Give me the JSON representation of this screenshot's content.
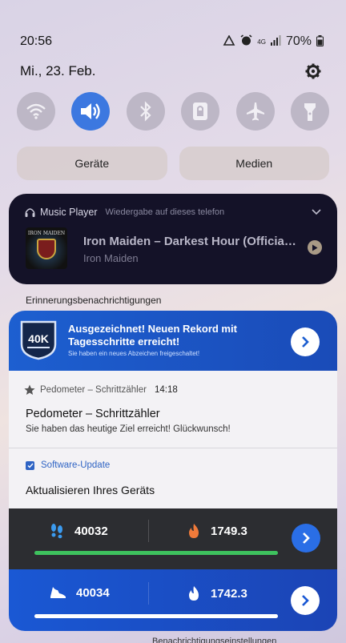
{
  "status_bar": {
    "time": "20:56",
    "network": "4G",
    "battery": "70%"
  },
  "date": "Mi., 23. Feb.",
  "quick_settings": [
    {
      "name": "wifi",
      "active": false
    },
    {
      "name": "sound",
      "active": true
    },
    {
      "name": "bluetooth",
      "active": false
    },
    {
      "name": "rotation-lock",
      "active": false
    },
    {
      "name": "airplane-mode",
      "active": false
    },
    {
      "name": "flashlight",
      "active": false
    }
  ],
  "segments": {
    "devices": "Geräte",
    "media": "Medien"
  },
  "media_player": {
    "app_name": "Music Player",
    "device_text": "Wiedergabe auf dieses telefon",
    "album_band": "IRON MAIDEN",
    "track_title": "Iron Maiden – Darkest Hour (Official Video)",
    "artist": "Iron Maiden"
  },
  "section_label": "Erinnerungsbenachrichtigungen",
  "record_card": {
    "badge_text": "40K",
    "title": "Ausgezeichnet! Neuen Rekord mit Tagesschritte erreicht!",
    "subtitle": "Sie haben ein neues Abzeichen freigeschaltet!"
  },
  "pedometer_notification": {
    "app": "Pedometer – Schrittzähler",
    "time": "14:18",
    "title": "Pedometer – Schrittzähler",
    "text": "Sie haben das heutige Ziel erreicht! Glückwunsch!"
  },
  "update_notification": {
    "app": "Software-Update",
    "title": "Aktualisieren Ihres Geräts"
  },
  "dark_stats": {
    "steps": "40032",
    "calories": "1749.3",
    "progress": 1.0
  },
  "blue_stats": {
    "steps": "40034",
    "calories": "1742.3",
    "progress": 1.0
  },
  "footer": "Benachrichtigungseinstellungen"
}
